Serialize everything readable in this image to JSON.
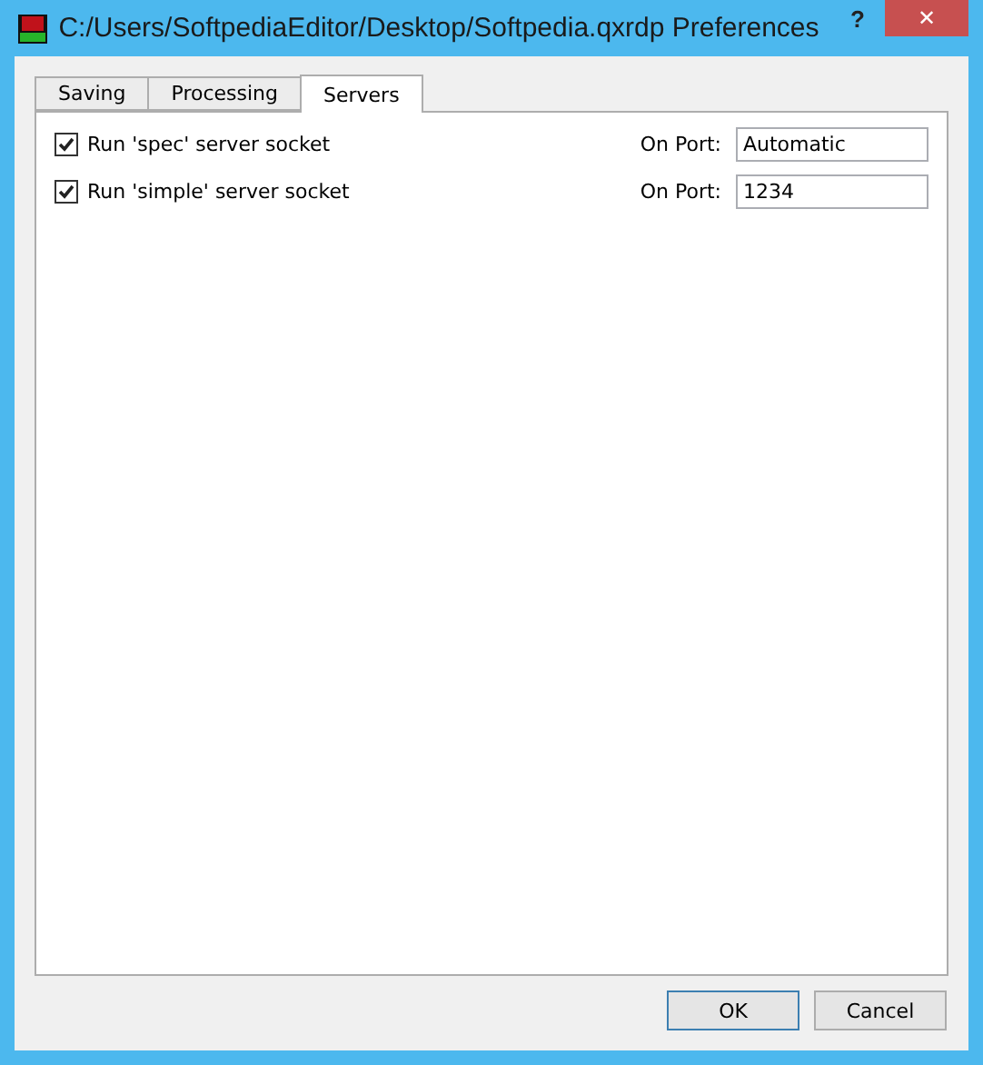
{
  "window": {
    "title": "C:/Users/SoftpediaEditor/Desktop/Softpedia.qxrdp Preferences",
    "help": "?",
    "close": "✕"
  },
  "tabs": [
    {
      "label": "Saving",
      "selected": false
    },
    {
      "label": "Processing",
      "selected": false
    },
    {
      "label": "Servers",
      "selected": true
    }
  ],
  "servers": [
    {
      "label": "Run 'spec' server socket",
      "checked": true,
      "port_label": "On Port:",
      "port": "Automatic"
    },
    {
      "label": "Run 'simple' server socket",
      "checked": true,
      "port_label": "On Port:",
      "port": "1234"
    }
  ],
  "buttons": [
    {
      "label": "OK",
      "kind": "default"
    },
    {
      "label": "Cancel",
      "kind": "normal"
    }
  ]
}
